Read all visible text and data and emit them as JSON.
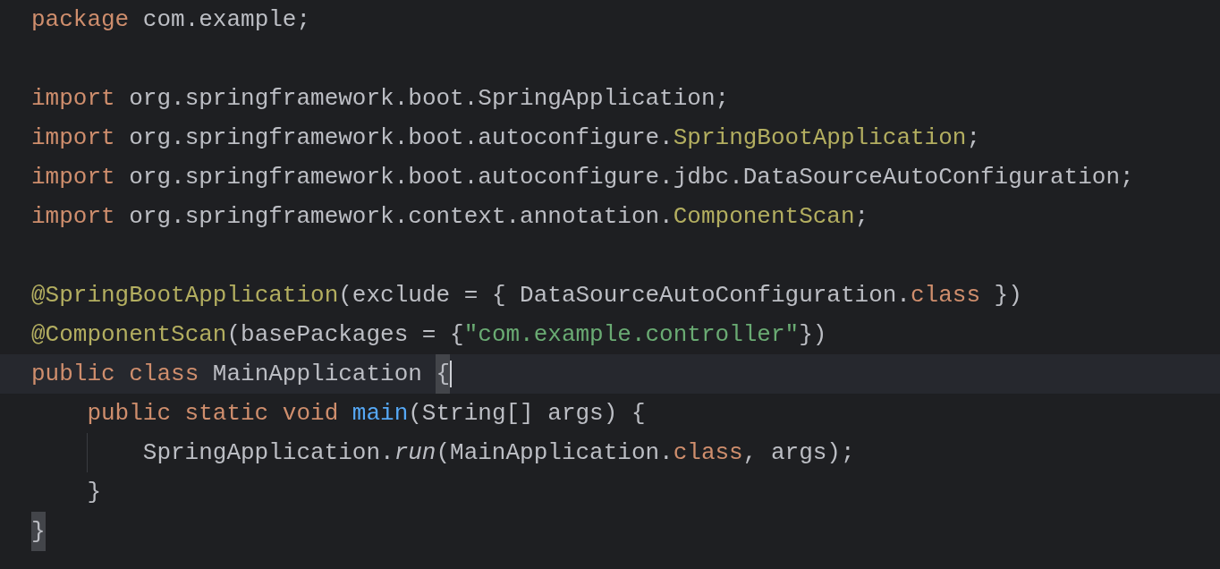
{
  "editor": {
    "blocks": [
      [
        {
          "current": false,
          "tokens": [
            {
              "text": "package",
              "kind": "keyword"
            },
            {
              "text": " com.example;",
              "kind": "plain"
            }
          ]
        }
      ],
      [
        {
          "current": false,
          "tokens": [
            {
              "text": "import",
              "kind": "keyword"
            },
            {
              "text": " org.springframework.boot.SpringApplication;",
              "kind": "plain"
            }
          ]
        },
        {
          "current": false,
          "tokens": [
            {
              "text": "import",
              "kind": "keyword"
            },
            {
              "text": " org.springframework.boot.autoconfigure.",
              "kind": "plain"
            },
            {
              "text": "SpringBootApplication",
              "kind": "annotation"
            },
            {
              "text": ";",
              "kind": "plain"
            }
          ]
        },
        {
          "current": false,
          "tokens": [
            {
              "text": "import",
              "kind": "keyword"
            },
            {
              "text": " org.springframework.boot.autoconfigure.jdbc.DataSourceAutoConfiguration;",
              "kind": "plain"
            }
          ]
        },
        {
          "current": false,
          "tokens": [
            {
              "text": "import",
              "kind": "keyword"
            },
            {
              "text": " org.springframework.context.annotation.",
              "kind": "plain"
            },
            {
              "text": "ComponentScan",
              "kind": "annotation"
            },
            {
              "text": ";",
              "kind": "plain"
            }
          ]
        }
      ],
      [
        {
          "current": false,
          "tokens": [
            {
              "text": "@SpringBootApplication",
              "kind": "annotation"
            },
            {
              "text": "(exclude = { DataSourceAutoConfiguration.",
              "kind": "plain"
            },
            {
              "text": "class",
              "kind": "keyword"
            },
            {
              "text": " })",
              "kind": "plain"
            }
          ]
        },
        {
          "current": false,
          "tokens": [
            {
              "text": "@ComponentScan",
              "kind": "annotation"
            },
            {
              "text": "(basePackages = {",
              "kind": "plain"
            },
            {
              "text": "\"com.example.controller\"",
              "kind": "string"
            },
            {
              "text": "})",
              "kind": "plain"
            }
          ]
        },
        {
          "current": true,
          "tokens": [
            {
              "text": "public class",
              "kind": "keyword"
            },
            {
              "text": " MainApplication ",
              "kind": "plain"
            },
            {
              "text": "{",
              "kind": "plain",
              "matched": true,
              "caret": true
            }
          ],
          "children": [
            {
              "current": false,
              "tokens": [
                {
                  "text": "public static void",
                  "kind": "keyword"
                },
                {
                  "text": " main",
                  "kind": "method"
                },
                {
                  "text": "(String[] args) {",
                  "kind": "plain"
                }
              ],
              "children": [
                {
                  "current": false,
                  "tokens": [
                    {
                      "text": "SpringApplication.",
                      "kind": "plain"
                    },
                    {
                      "text": "run",
                      "kind": "static"
                    },
                    {
                      "text": "(MainApplication.",
                      "kind": "plain"
                    },
                    {
                      "text": "class",
                      "kind": "keyword"
                    },
                    {
                      "text": ", args);",
                      "kind": "plain"
                    }
                  ]
                }
              ]
            },
            {
              "current": false,
              "tokens": [
                {
                  "text": "}",
                  "kind": "plain"
                }
              ]
            }
          ]
        },
        {
          "current": false,
          "tokens": [
            {
              "text": "}",
              "kind": "plain",
              "matched": true
            }
          ]
        }
      ]
    ]
  }
}
